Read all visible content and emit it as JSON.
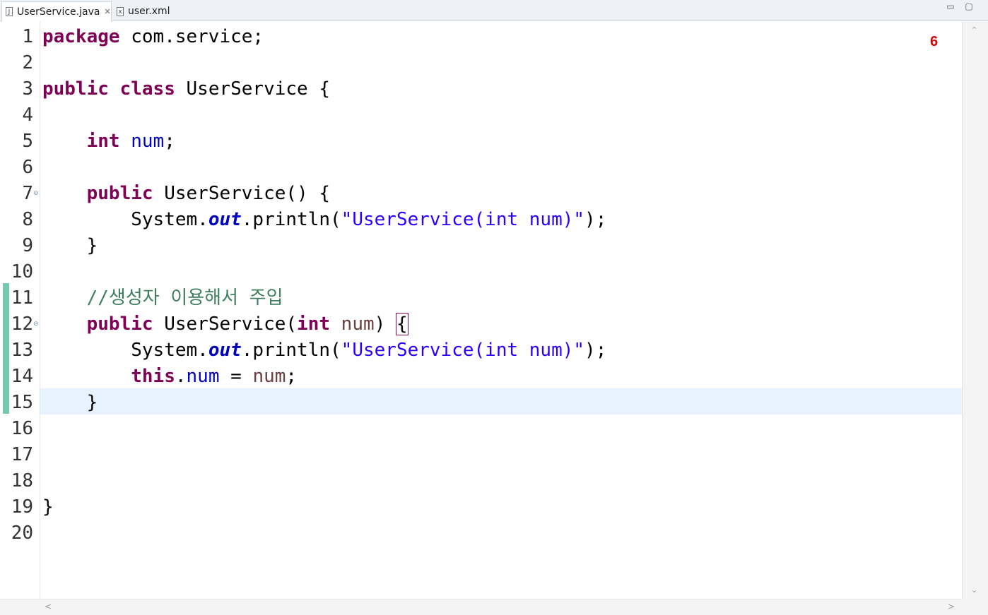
{
  "tabs": [
    {
      "label": "UserService.java",
      "icon": "java-file-icon",
      "close": "✕"
    },
    {
      "label": "user.xml",
      "icon": "xml-file-icon"
    }
  ],
  "window": {
    "minimize": "▭",
    "maximize": "▢"
  },
  "marker_count": "6",
  "line_numbers": [
    "1",
    "2",
    "3",
    "4",
    "5",
    "6",
    "7",
    "8",
    "9",
    "10",
    "11",
    "12",
    "13",
    "14",
    "15",
    "16",
    "17",
    "18",
    "19",
    "20"
  ],
  "code": {
    "l1_kw": "package",
    "l1_rest": " com.service;",
    "l3_kw1": "public",
    "l3_kw2": "class",
    "l3_rest": " UserService {",
    "l5_kw": "int",
    "l5_field": "num",
    "l5_end": ";",
    "l7_kw": "public",
    "l7_rest": " UserService() {",
    "l8_a": "System.",
    "l8_field": "out",
    "l8_b": ".println(",
    "l8_str": "\"UserService(int num)\"",
    "l8_c": ");",
    "l9": "}",
    "l11_cmt": "//생성자 이용해서 주입",
    "l12_kw": "public",
    "l12_a": " UserService(",
    "l12_kw2": "int",
    "l12_param": "num",
    "l12_b": ") ",
    "l12_brace": "{",
    "l13_a": "System.",
    "l13_field": "out",
    "l13_b": ".println(",
    "l13_str": "\"UserService(int num)\"",
    "l13_c": ");",
    "l14_kw": "this",
    "l14_dot": ".",
    "l14_field": "num",
    "l14_eq": " = ",
    "l14_param": "num",
    "l14_end": ";",
    "l15": "}",
    "l19": "}"
  },
  "scroll": {
    "up": "⌃",
    "down": "⌄",
    "left": "<",
    "right": ">"
  },
  "colors": {
    "keyword": "#7f0055",
    "field": "#0000c0",
    "string": "#2a00ff",
    "comment": "#3f7f5f",
    "current_line": "#e8f2fe",
    "marker": "#e00000"
  }
}
